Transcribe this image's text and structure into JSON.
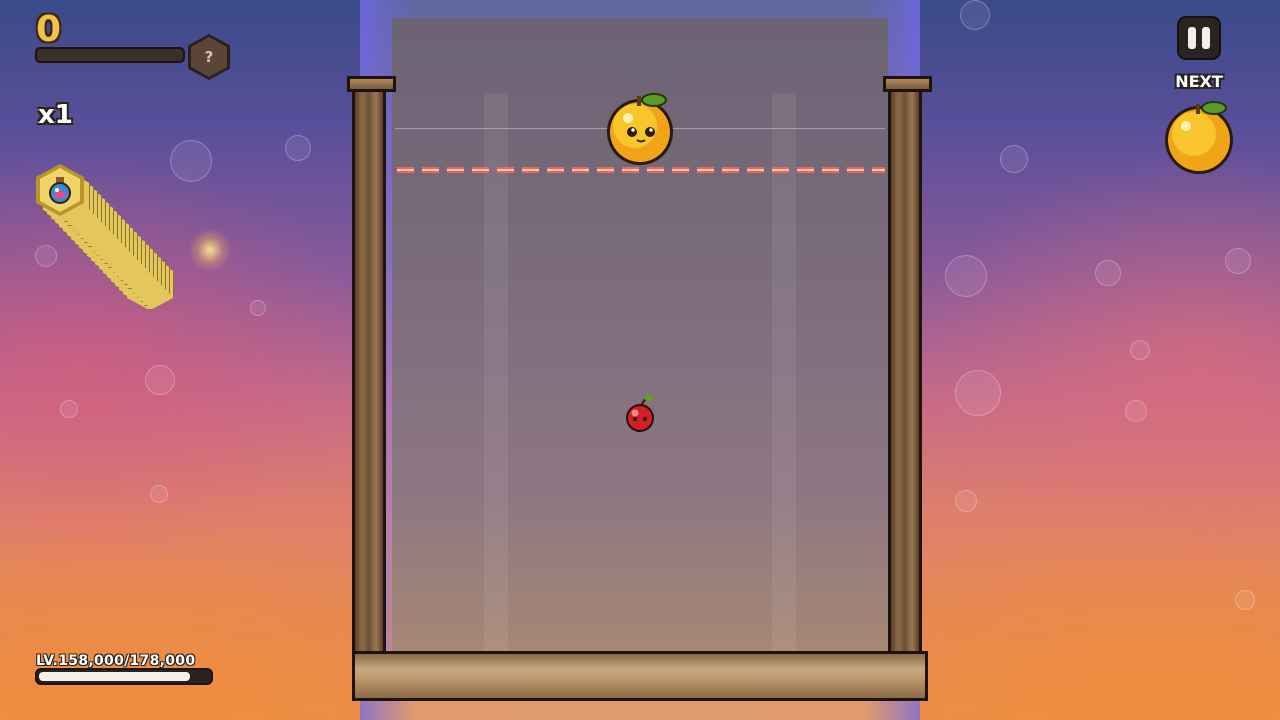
{
  "hud": {
    "score": "0",
    "score_progress": 0.0,
    "mystery_badge": "?",
    "multiplier": "x1",
    "level_text": "LV.158,000/178,000",
    "level_progress": 0.888
  },
  "controls": {
    "pause_label": "pause"
  },
  "next": {
    "label": "NEXT",
    "fruit": "orange"
  },
  "board": {
    "held_fruit": "orange",
    "dropped_fruits": [
      "cherry"
    ],
    "limit_line_color": "#e86a55"
  },
  "powerup": {
    "icon": "potion-icon"
  },
  "colors": {
    "accent_gold": "#f2c14e",
    "wood": "#8c6a47"
  }
}
